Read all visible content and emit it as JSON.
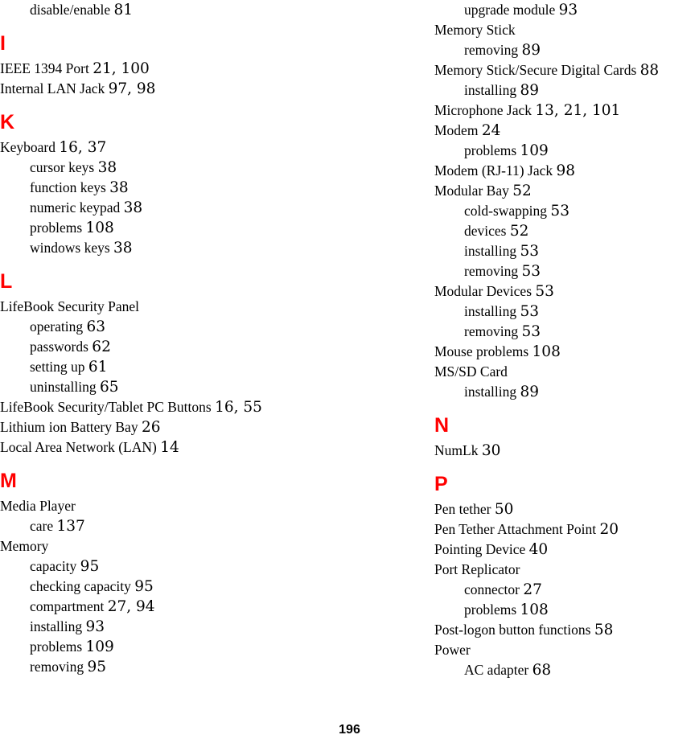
{
  "document": {
    "type": "index-page",
    "page_number": "196",
    "heading_color": "#ff0000",
    "text_color": "#000000",
    "background_color": "#ffffff"
  },
  "columns": [
    {
      "id": "left-column",
      "blocks": [
        {
          "type": "entries",
          "entries": [
            {
              "level": 2,
              "text": "disable/enable",
              "pages": "81"
            }
          ]
        },
        {
          "type": "letter",
          "letter": "I",
          "entries": [
            {
              "level": 1,
              "text": "IEEE 1394 Port",
              "pages": "21, 100"
            },
            {
              "level": 1,
              "text": "Internal LAN Jack",
              "pages": "97, 98"
            }
          ]
        },
        {
          "type": "letter",
          "letter": "K",
          "entries": [
            {
              "level": 1,
              "text": "Keyboard",
              "pages": "16, 37"
            },
            {
              "level": 2,
              "text": "cursor keys",
              "pages": "38"
            },
            {
              "level": 2,
              "text": "function keys",
              "pages": "38"
            },
            {
              "level": 2,
              "text": "numeric keypad",
              "pages": "38"
            },
            {
              "level": 2,
              "text": "problems",
              "pages": "108"
            },
            {
              "level": 2,
              "text": "windows keys",
              "pages": "38"
            }
          ]
        },
        {
          "type": "letter",
          "letter": "L",
          "entries": [
            {
              "level": 1,
              "text": "LifeBook Security Panel",
              "pages": ""
            },
            {
              "level": 2,
              "text": "operating",
              "pages": "63"
            },
            {
              "level": 2,
              "text": "passwords",
              "pages": "62"
            },
            {
              "level": 2,
              "text": "setting up",
              "pages": "61"
            },
            {
              "level": 2,
              "text": "uninstalling",
              "pages": "65"
            },
            {
              "level": 1,
              "text": "LifeBook Security/Tablet PC Buttons",
              "pages": "16, 55"
            },
            {
              "level": 1,
              "text": "Lithium ion Battery Bay",
              "pages": "26"
            },
            {
              "level": 1,
              "text": "Local Area Network (LAN)",
              "pages": "14"
            }
          ]
        },
        {
          "type": "letter",
          "letter": "M",
          "entries": [
            {
              "level": 1,
              "text": "Media Player",
              "pages": ""
            },
            {
              "level": 2,
              "text": "care",
              "pages": "137"
            },
            {
              "level": 1,
              "text": "Memory",
              "pages": ""
            },
            {
              "level": 2,
              "text": "capacity",
              "pages": "95"
            },
            {
              "level": 2,
              "text": "checking capacity",
              "pages": "95"
            },
            {
              "level": 2,
              "text": "compartment",
              "pages": "27, 94"
            },
            {
              "level": 2,
              "text": "installing",
              "pages": "93"
            },
            {
              "level": 2,
              "text": "problems",
              "pages": "109"
            },
            {
              "level": 2,
              "text": "removing",
              "pages": "95"
            }
          ]
        }
      ]
    },
    {
      "id": "right-column",
      "blocks": [
        {
          "type": "entries",
          "entries": [
            {
              "level": 2,
              "text": "upgrade module",
              "pages": "93"
            },
            {
              "level": 1,
              "text": "Memory Stick",
              "pages": ""
            },
            {
              "level": 2,
              "text": "removing",
              "pages": "89"
            },
            {
              "level": 1,
              "text": "Memory Stick/Secure Digital Cards",
              "pages": "88"
            },
            {
              "level": 2,
              "text": "installing",
              "pages": "89"
            },
            {
              "level": 1,
              "text": "Microphone Jack",
              "pages": "13, 21, 101"
            },
            {
              "level": 1,
              "text": "Modem",
              "pages": "24"
            },
            {
              "level": 2,
              "text": "problems",
              "pages": "109"
            },
            {
              "level": 1,
              "text": "Modem (RJ-11) Jack",
              "pages": "98"
            },
            {
              "level": 1,
              "text": "Modular Bay",
              "pages": "52"
            },
            {
              "level": 2,
              "text": "cold-swapping",
              "pages": "53"
            },
            {
              "level": 2,
              "text": "devices",
              "pages": "52"
            },
            {
              "level": 2,
              "text": "installing",
              "pages": "53"
            },
            {
              "level": 2,
              "text": "removing",
              "pages": "53"
            },
            {
              "level": 1,
              "text": "Modular Devices",
              "pages": "53"
            },
            {
              "level": 2,
              "text": "installing",
              "pages": "53"
            },
            {
              "level": 2,
              "text": "removing",
              "pages": "53"
            },
            {
              "level": 1,
              "text": "Mouse problems",
              "pages": "108"
            },
            {
              "level": 1,
              "text": "MS/SD Card",
              "pages": ""
            },
            {
              "level": 2,
              "text": "installing",
              "pages": "89"
            }
          ]
        },
        {
          "type": "letter",
          "letter": "N",
          "entries": [
            {
              "level": 1,
              "text": "NumLk",
              "pages": "30"
            }
          ]
        },
        {
          "type": "letter",
          "letter": "P",
          "entries": [
            {
              "level": 1,
              "text": "Pen tether",
              "pages": "50"
            },
            {
              "level": 1,
              "text": "Pen Tether Attachment Point",
              "pages": "20"
            },
            {
              "level": 1,
              "text": "Pointing Device",
              "pages": "40"
            },
            {
              "level": 1,
              "text": "Port Replicator",
              "pages": ""
            },
            {
              "level": 2,
              "text": "connector",
              "pages": "27"
            },
            {
              "level": 2,
              "text": "problems",
              "pages": "108"
            },
            {
              "level": 1,
              "text": "Post-logon button functions",
              "pages": "58"
            },
            {
              "level": 1,
              "text": "Power",
              "pages": ""
            },
            {
              "level": 2,
              "text": "AC adapter",
              "pages": "68"
            }
          ]
        }
      ]
    }
  ]
}
